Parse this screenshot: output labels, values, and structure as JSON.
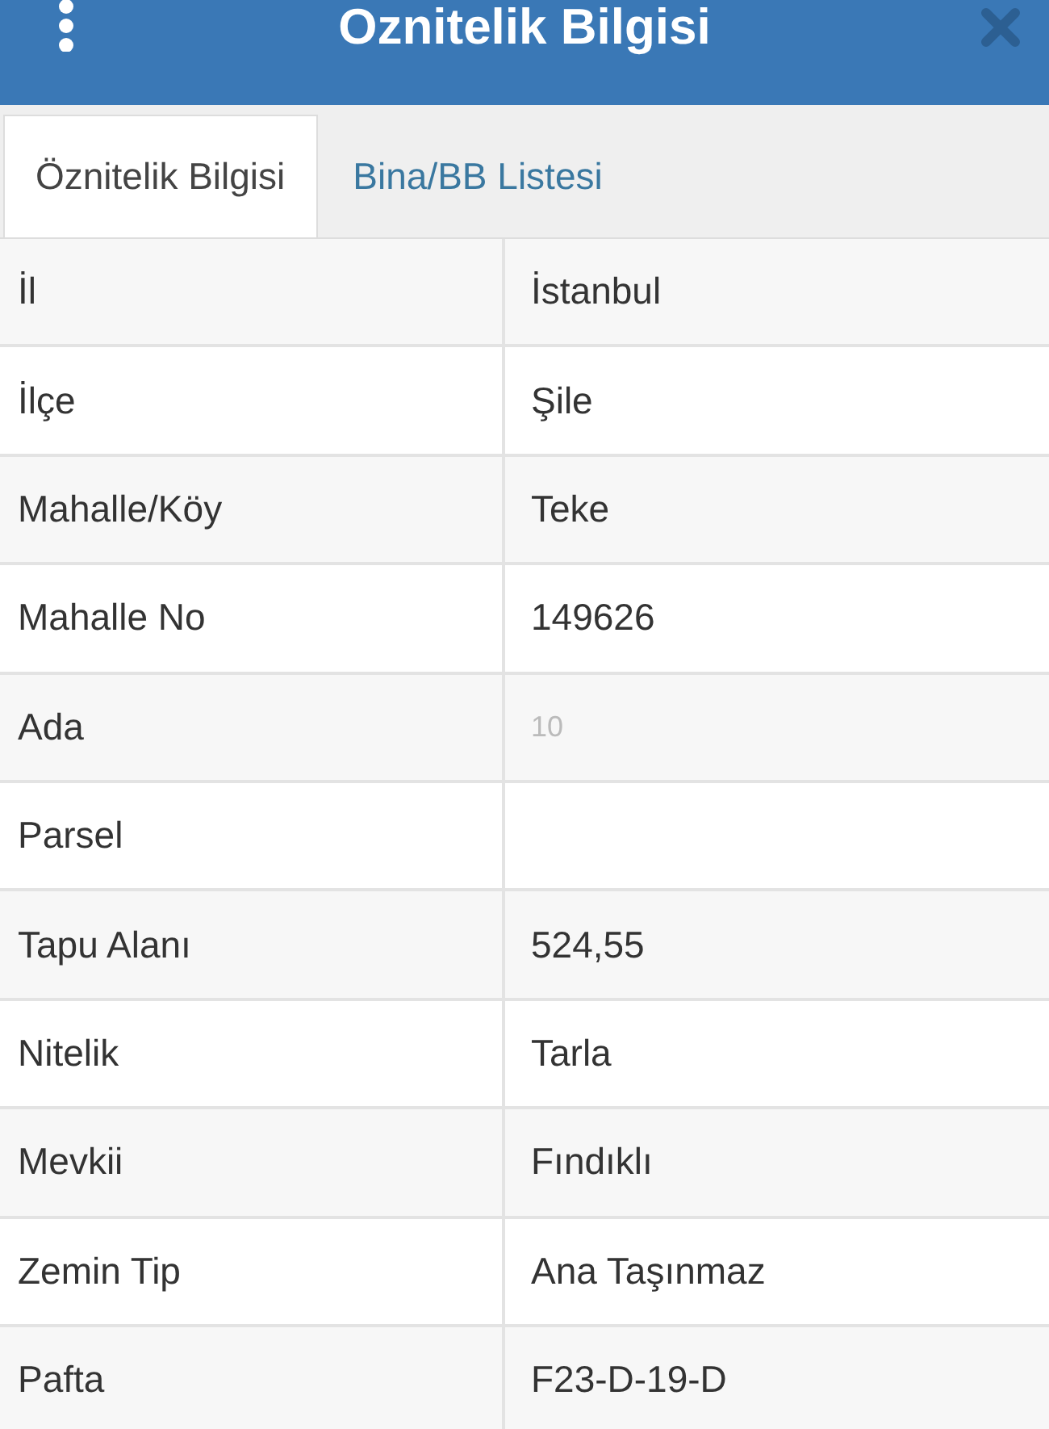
{
  "header": {
    "title": "Oznitelik Bilgisi"
  },
  "tabs": [
    {
      "label": "Öznitelik Bilgisi",
      "selected": true
    },
    {
      "label": "Bina/BB Listesi",
      "selected": false
    }
  ],
  "rows": [
    {
      "label": "İl",
      "value": "İstanbul"
    },
    {
      "label": "İlçe",
      "value": "Şile"
    },
    {
      "label": "Mahalle/Köy",
      "value": "Teke"
    },
    {
      "label": "Mahalle No",
      "value": "149626"
    },
    {
      "label": "Ada",
      "value": "10",
      "obscured": true
    },
    {
      "label": "Parsel"
    },
    {
      "label": "Tapu Alanı",
      "value": "524,55"
    },
    {
      "label": "Nitelik",
      "value": "Tarla"
    },
    {
      "label": "Mevkii",
      "value": "Fındıklı"
    },
    {
      "label": "Zemin Tip",
      "value": "Ana Taşınmaz"
    },
    {
      "label": "Pafta",
      "value": "F23-D-19-D"
    }
  ]
}
